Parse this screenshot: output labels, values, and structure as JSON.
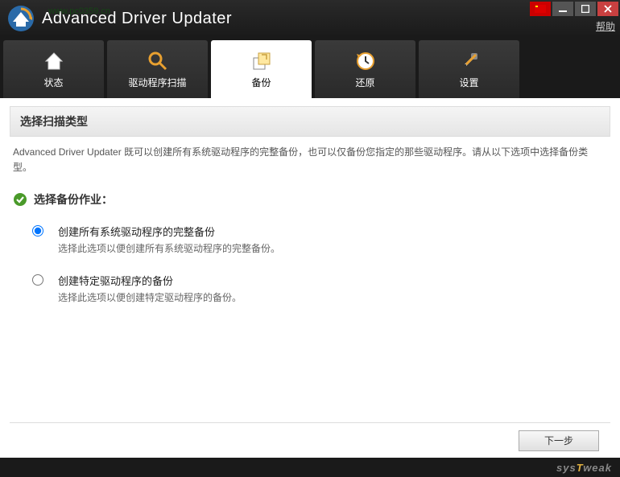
{
  "app": {
    "title": "Advanced Driver Updater",
    "watermark": "www.pc0359.cn",
    "help": "帮助"
  },
  "tabs": {
    "status": "状态",
    "scan": "驱动程序扫描",
    "backup": "备份",
    "restore": "还原",
    "settings": "设置"
  },
  "panel": {
    "header": "选择扫描类型",
    "desc": "Advanced Driver Updater 既可以创建所有系统驱动程序的完整备份，也可以仅备份您指定的那些驱动程序。请从以下选项中选择备份类型。"
  },
  "section": {
    "title": "选择备份作业："
  },
  "options": {
    "full": {
      "label": "创建所有系统驱动程序的完整备份",
      "desc": "选择此选项以便创建所有系统驱动程序的完整备份。"
    },
    "specific": {
      "label": "创建特定驱动程序的备份",
      "desc": "选择此选项以便创建特定驱动程序的备份。"
    }
  },
  "footer": {
    "next": "下一步"
  },
  "brand": {
    "pre": "sys",
    "hl": "T",
    "post": "weak"
  }
}
